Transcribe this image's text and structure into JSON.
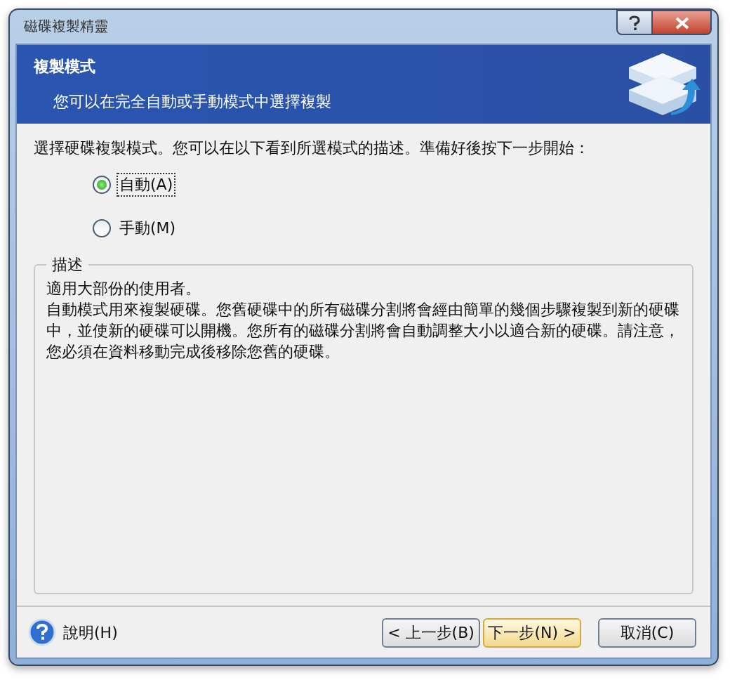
{
  "window": {
    "title": "磁碟複製精靈"
  },
  "header": {
    "title": "複製模式",
    "subtitle": "您可以在完全自動或手動模式中選擇複製"
  },
  "prompt": "選擇硬碟複製模式。您可以在以下看到所選模式的描述。準備好後按下一步開始：",
  "modes": [
    {
      "label": "自動(A)",
      "selected": true
    },
    {
      "label": "手動(M)",
      "selected": false
    }
  ],
  "description": {
    "legend": "描述",
    "lines": [
      "適用大部份的使用者。",
      "自動模式用來複製硬碟。您舊硬碟中的所有磁碟分割將會經由簡單的幾個步驟複製到新的硬碟中，並使新的硬碟可以開機。您所有的磁碟分割將會自動調整大小以適合新的硬碟。請注意，您必須在資料移動完成後移除您舊的硬碟。"
    ]
  },
  "footer": {
    "help": "說明(H)",
    "buttons": [
      {
        "label": "< 上一步(B)",
        "default": false
      },
      {
        "label": "下一步(N) >",
        "default": true
      },
      {
        "label": "取消(C)",
        "default": false
      }
    ]
  }
}
